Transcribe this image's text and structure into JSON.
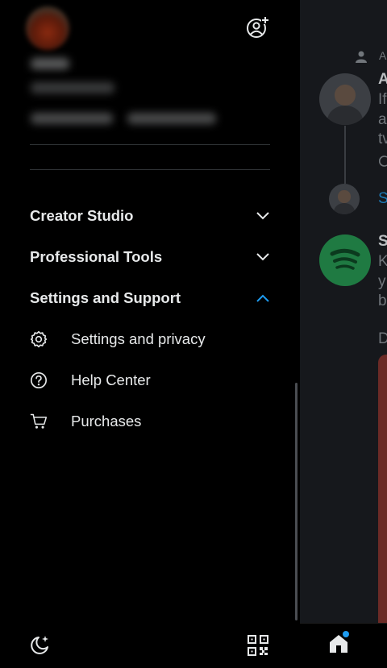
{
  "drawer": {
    "sections": [
      {
        "label": "Creator Studio",
        "expanded": false
      },
      {
        "label": "Professional Tools",
        "expanded": false
      },
      {
        "label": "Settings and Support",
        "expanded": true
      }
    ],
    "items": [
      {
        "label": "Settings and privacy",
        "icon": "gear-icon"
      },
      {
        "label": "Help Center",
        "icon": "help-icon"
      },
      {
        "label": "Purchases",
        "icon": "cart-icon"
      }
    ]
  },
  "timeline": {
    "row1_letter": "A",
    "row2_letter": "If",
    "row3_letter": "a",
    "row4_letter": "tv",
    "header_letter": "A",
    "show_letter": "S",
    "spotify_name_letter": "S",
    "spotify_lines": [
      "K",
      "y",
      "b"
    ],
    "section_letter": "D"
  },
  "colors": {
    "accent": "#1d9bf0",
    "background": "#000000",
    "text": "#e7e9ea",
    "divider": "#2f3336"
  }
}
